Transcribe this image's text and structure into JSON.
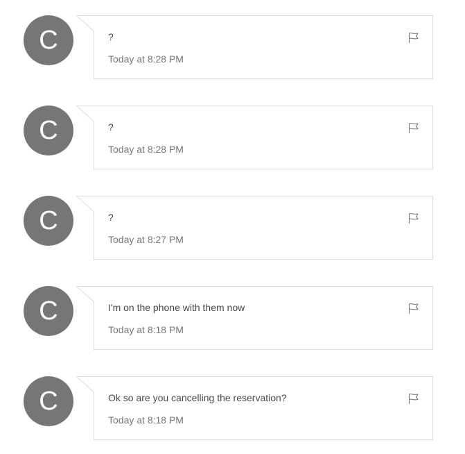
{
  "messages": [
    {
      "avatar_initial": "C",
      "text": "?",
      "time": "Today at 8:28 PM",
      "flag_icon": "flag-icon"
    },
    {
      "avatar_initial": "C",
      "text": "?",
      "time": "Today at 8:28 PM",
      "flag_icon": "flag-icon"
    },
    {
      "avatar_initial": "C",
      "text": "?",
      "time": "Today at 8:27 PM",
      "flag_icon": "flag-icon"
    },
    {
      "avatar_initial": "C",
      "text": "I'm on the phone with them now",
      "time": "Today at 8:18 PM",
      "flag_icon": "flag-icon"
    },
    {
      "avatar_initial": "C",
      "text": "Ok so are you cancelling the reservation?",
      "time": "Today at 8:18 PM",
      "flag_icon": "flag-icon"
    }
  ],
  "colors": {
    "avatar_bg": "#767676",
    "text": "#484848",
    "time": "#767676",
    "border": "#dddddd"
  }
}
